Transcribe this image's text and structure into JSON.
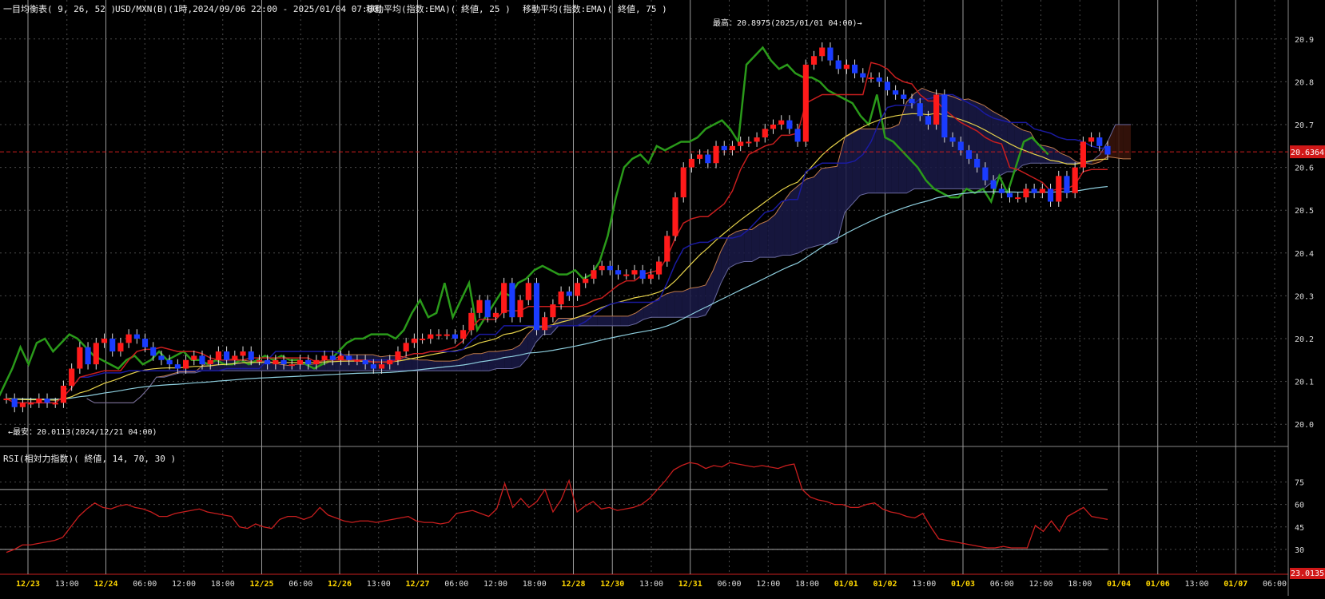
{
  "header": {
    "indicator": "一目均衡表( 9, 26, 52 )",
    "symbol": "USD/MXN(B)(1時,2024/09/06 22:00 - 2025/01/04 07:00)",
    "ema25": "移動平均(指数:EMA)( 終値, 25 )",
    "ema75": "移動平均(指数:EMA)( 終値, 75 )"
  },
  "annotations": {
    "high": "最高：20.8975(2025/01/01 04:00)→",
    "low": "←最安：20.0113(2024/12/21 04:00)"
  },
  "rsi_header": "RSI(相対力指数)( 終値, 14, 70, 30 )",
  "badges": {
    "price": "20.6364",
    "rsi": "23.0135"
  },
  "colors": {
    "bull": "#ff1a1a",
    "bear": "#1a3cff",
    "tenkan": "#c81e1e",
    "kijun": "#1a1aa0",
    "chikou": "#2a9a1a",
    "ema25": "#e6d24a",
    "ema75": "#8fd0e0",
    "span_a": "#c07a4a",
    "span_b": "#6a6aa0",
    "kumo_bear": "#3a140a",
    "kumo_bull": "#1a1a48",
    "rsi": "#c81e1e",
    "grid": "#4a4a4a",
    "accent": "#ffd700"
  },
  "chart_data": [
    {
      "type": "candlestick",
      "title": "USD/MXN(B) 1時",
      "ylim": [
        19.95,
        20.95
      ],
      "y_ticks": [
        "20.9",
        "20.8",
        "20.7",
        "20.6",
        "20.5",
        "20.4",
        "20.3",
        "20.2",
        "20.1",
        "20.0"
      ],
      "x_ticks": [
        {
          "label": "12/23",
          "major": true
        },
        {
          "label": "13:00",
          "major": false
        },
        {
          "label": "12/24",
          "major": true
        },
        {
          "label": "06:00",
          "major": false
        },
        {
          "label": "12:00",
          "major": false
        },
        {
          "label": "18:00",
          "major": false
        },
        {
          "label": "12/25",
          "major": true
        },
        {
          "label": "06:00",
          "major": false
        },
        {
          "label": "12/26",
          "major": true
        },
        {
          "label": "13:00",
          "major": false
        },
        {
          "label": "12/27",
          "major": true
        },
        {
          "label": "06:00",
          "major": false
        },
        {
          "label": "12:00",
          "major": false
        },
        {
          "label": "18:00",
          "major": false
        },
        {
          "label": "12/28",
          "major": true
        },
        {
          "label": "12/30",
          "major": true
        },
        {
          "label": "13:00",
          "major": false
        },
        {
          "label": "12/31",
          "major": true
        },
        {
          "label": "06:00",
          "major": false
        },
        {
          "label": "12:00",
          "major": false
        },
        {
          "label": "18:00",
          "major": false
        },
        {
          "label": "01/01",
          "major": true
        },
        {
          "label": "01/02",
          "major": true
        },
        {
          "label": "13:00",
          "major": false
        },
        {
          "label": "01/03",
          "major": true
        },
        {
          "label": "06:00",
          "major": false
        },
        {
          "label": "12:00",
          "major": false
        },
        {
          "label": "18:00",
          "major": false
        },
        {
          "label": "01/04",
          "major": true
        },
        {
          "label": "01/06",
          "major": true
        },
        {
          "label": "13:00",
          "major": false
        },
        {
          "label": "01/07",
          "major": true
        },
        {
          "label": "06:00",
          "major": false
        }
      ],
      "current_price": 20.6364,
      "high": 20.8975,
      "low": 20.0113,
      "closes": [
        20.06,
        20.04,
        20.05,
        20.05,
        20.06,
        20.05,
        20.05,
        20.09,
        20.13,
        20.18,
        20.14,
        20.19,
        20.2,
        20.17,
        20.19,
        20.21,
        20.2,
        20.18,
        20.16,
        20.15,
        20.14,
        20.13,
        20.15,
        20.16,
        20.14,
        20.15,
        20.17,
        20.15,
        20.16,
        20.17,
        20.15,
        20.15,
        20.14,
        20.15,
        20.14,
        20.14,
        20.15,
        20.14,
        20.15,
        20.16,
        20.15,
        20.16,
        20.15,
        20.15,
        20.14,
        20.13,
        20.14,
        20.15,
        20.17,
        20.19,
        20.2,
        20.2,
        20.21,
        20.21,
        20.21,
        20.2,
        20.22,
        20.26,
        20.29,
        20.25,
        20.26,
        20.33,
        20.25,
        20.29,
        20.33,
        20.22,
        20.25,
        20.28,
        20.31,
        20.3,
        20.33,
        20.34,
        20.36,
        20.37,
        20.36,
        20.35,
        20.35,
        20.36,
        20.34,
        20.35,
        20.38,
        20.44,
        20.53,
        20.6,
        20.62,
        20.63,
        20.61,
        20.65,
        20.64,
        20.65,
        20.66,
        20.66,
        20.67,
        20.69,
        20.7,
        20.71,
        20.69,
        20.66,
        20.84,
        20.86,
        20.88,
        20.85,
        20.83,
        20.84,
        20.82,
        20.81,
        20.81,
        20.8,
        20.78,
        20.77,
        20.76,
        20.75,
        20.72,
        20.7,
        20.77,
        20.67,
        20.66,
        20.64,
        20.62,
        20.6,
        20.57,
        20.55,
        20.54,
        20.53,
        20.53,
        20.55,
        20.54,
        20.55,
        20.52,
        20.58,
        20.54,
        20.6,
        20.66,
        20.67,
        20.65,
        20.63
      ]
    },
    {
      "type": "line",
      "title": "RSI",
      "ylim": [
        15,
        95
      ],
      "y_ticks": [
        "75",
        "60",
        "45",
        "30"
      ],
      "levels": [
        70,
        30
      ],
      "values": [
        28,
        30,
        33,
        33,
        34,
        35,
        36,
        38,
        45,
        52,
        57,
        61,
        58,
        57,
        59,
        60,
        58,
        57,
        55,
        52,
        52,
        54,
        55,
        56,
        57,
        55,
        54,
        53,
        52,
        45,
        44,
        47,
        45,
        44,
        50,
        52,
        52,
        50,
        52,
        58,
        53,
        51,
        49,
        48,
        49,
        49,
        48,
        49,
        50,
        51,
        52,
        49,
        48,
        48,
        47,
        48,
        54,
        55,
        56,
        54,
        52,
        57,
        74,
        58,
        64,
        58,
        62,
        70,
        55,
        63,
        76,
        55,
        59,
        62,
        57,
        58,
        56,
        57,
        58,
        60,
        64,
        70,
        76,
        83,
        86,
        88,
        87,
        84,
        86,
        85,
        88,
        87,
        86,
        85,
        86,
        85,
        84,
        86,
        87,
        70,
        65,
        63,
        62,
        60,
        60,
        58,
        58,
        60,
        61,
        57,
        55,
        54,
        52,
        51,
        54,
        45,
        37,
        36,
        35,
        34,
        33,
        32,
        31,
        31,
        32,
        31,
        31,
        31,
        46,
        42,
        49,
        42,
        52,
        55,
        58,
        52,
        51,
        50
      ]
    }
  ]
}
